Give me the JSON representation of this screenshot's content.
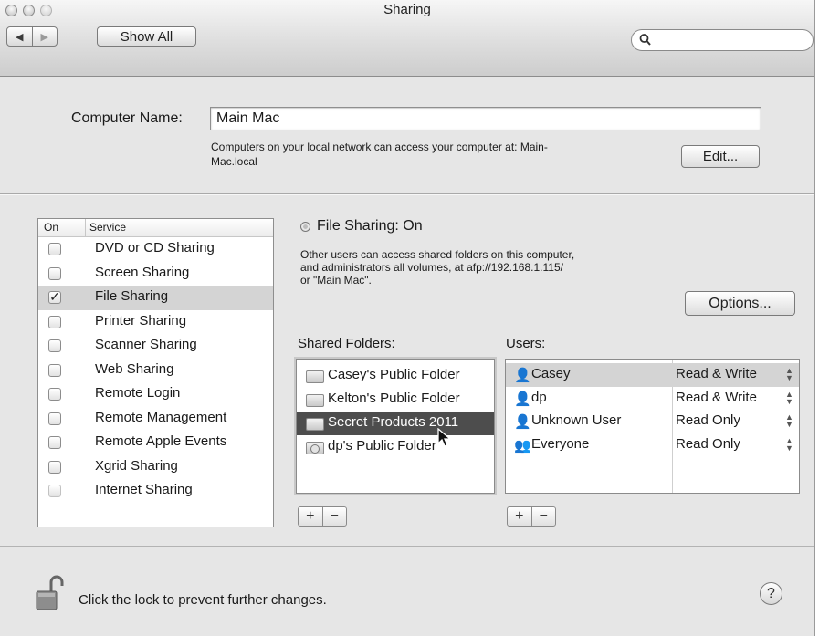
{
  "window": {
    "title": "Sharing"
  },
  "toolbar": {
    "back_glyph": "◀",
    "forward_glyph": "▶",
    "show_all_label": "Show All",
    "search_placeholder": ""
  },
  "computer_name": {
    "label": "Computer Name:",
    "value": "Main Mac",
    "note_line1": "Computers on your local network can access your computer at: Main-",
    "note_line2": "Mac.local",
    "edit_label": "Edit..."
  },
  "services": {
    "header_on": "On",
    "header_service": "Service",
    "items": [
      {
        "name": "DVD or CD Sharing",
        "checked": false
      },
      {
        "name": "Screen Sharing",
        "checked": false
      },
      {
        "name": "File Sharing",
        "checked": true,
        "selected": true
      },
      {
        "name": "Printer Sharing",
        "checked": false
      },
      {
        "name": "Scanner Sharing",
        "checked": false
      },
      {
        "name": "Web Sharing",
        "checked": false
      },
      {
        "name": "Remote Login",
        "checked": false
      },
      {
        "name": "Remote Management",
        "checked": false
      },
      {
        "name": "Remote Apple Events",
        "checked": false
      },
      {
        "name": "Xgrid Sharing",
        "checked": false
      },
      {
        "name": "Internet Sharing",
        "checked": false,
        "disabled": true
      }
    ]
  },
  "detail": {
    "status_title": "File Sharing: On",
    "desc_line1": "Other users can access shared folders on this computer,",
    "desc_line2": "and administrators all volumes, at afp://192.168.1.115/",
    "desc_line3": "or \"Main Mac\".",
    "options_label": "Options...",
    "shared_folders_label": "Shared Folders:",
    "users_label": "Users:",
    "folders": [
      {
        "name": "Casey's Public Folder",
        "icon": "folder-icon"
      },
      {
        "name": "Kelton's Public Folder",
        "icon": "folder-icon"
      },
      {
        "name": "Secret Products 2011",
        "icon": "folder-icon",
        "selected": true
      },
      {
        "name": "dp's Public Folder",
        "icon": "shared-folder-icon"
      }
    ],
    "users": [
      {
        "name": "Casey",
        "permission": "Read & Write",
        "selected": true,
        "icon": "user-icon"
      },
      {
        "name": "dp",
        "permission": "Read & Write",
        "icon": "user-icon"
      },
      {
        "name": "Unknown User",
        "permission": "Read Only",
        "icon": "user-icon"
      },
      {
        "name": "Everyone",
        "permission": "Read Only",
        "icon": "group-icon"
      }
    ],
    "plus_glyph": "+",
    "minus_glyph": "−"
  },
  "footer": {
    "lock_text": "Click the lock to prevent further changes.",
    "help_glyph": "?"
  }
}
